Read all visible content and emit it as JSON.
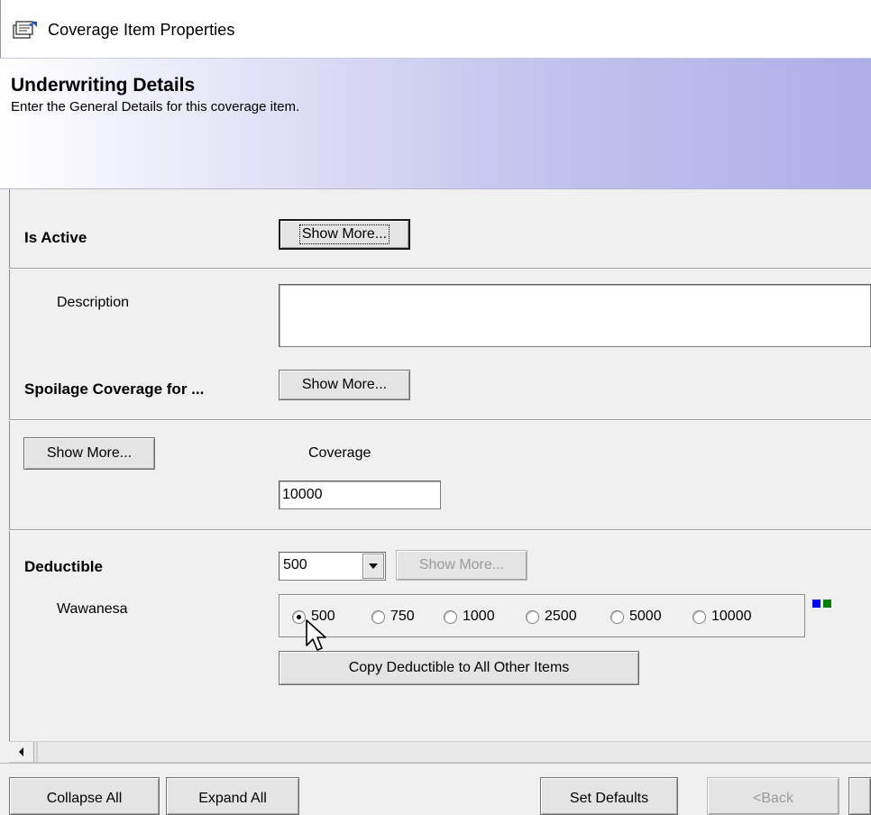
{
  "window": {
    "title": "Coverage Item Properties",
    "icon": "properties-icon"
  },
  "banner": {
    "heading": "Underwriting Details",
    "subheading": "Enter the General Details for this coverage item."
  },
  "fields": {
    "is_active": {
      "label": "Is Active",
      "button": "Show More..."
    },
    "description": {
      "label": "Description",
      "value": ""
    },
    "spoilage": {
      "label": "Spoilage Coverage for ...",
      "button": "Show More..."
    },
    "coverage": {
      "button": "Show More...",
      "label": "Coverage",
      "value": "10000"
    },
    "deductible": {
      "label": "Deductible",
      "selected": "500",
      "button": "Show More...",
      "carrier_label": "Wawanesa",
      "options": [
        "500",
        "750",
        "1000",
        "2500",
        "5000",
        "10000"
      ],
      "checked_option": "500",
      "copy_button": "Copy Deductible to All Other Items",
      "marker_colors": [
        "#0000ff",
        "#008000"
      ]
    }
  },
  "footer": {
    "collapse_all": "Collapse All",
    "expand_all": "Expand All",
    "set_defaults": "Set Defaults",
    "back": "<Back"
  }
}
